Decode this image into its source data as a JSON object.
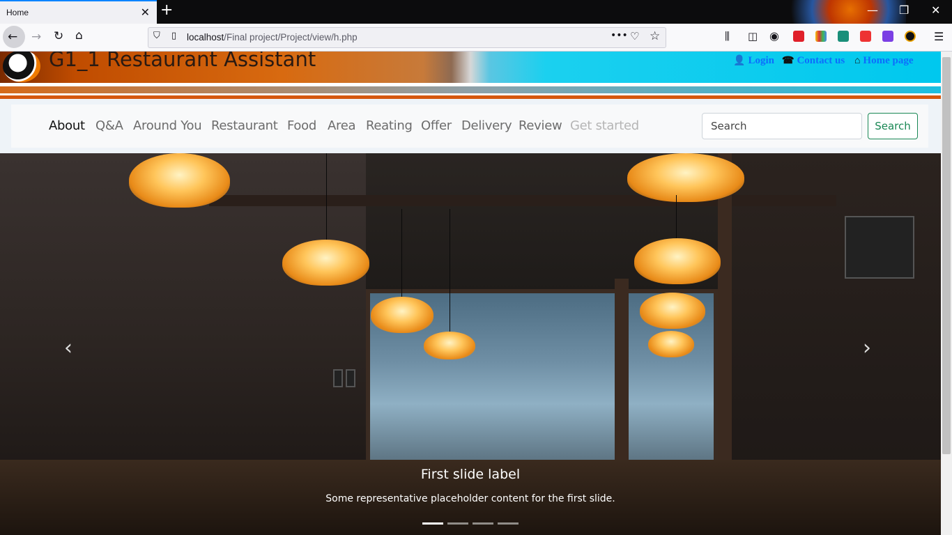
{
  "browser": {
    "tab_title": "Home",
    "url_host": "localhost",
    "url_path": "/Final project/Project/view/h.php"
  },
  "site": {
    "title": "G1_1 Restaurant Assistant",
    "top_links": [
      {
        "label": "Login",
        "icon": "user-icon"
      },
      {
        "label": "Contact us",
        "icon": "phone-icon"
      },
      {
        "label": "Home page",
        "icon": "home-icon"
      }
    ]
  },
  "menu": {
    "items": [
      {
        "label": "About",
        "state": "active"
      },
      {
        "label": "Q&A",
        "state": "normal"
      },
      {
        "label": "Around You",
        "state": "normal"
      },
      {
        "label": "Restaurant",
        "state": "normal"
      },
      {
        "label": "Food",
        "state": "normal"
      },
      {
        "label": "Area",
        "state": "normal"
      },
      {
        "label": "Reating",
        "state": "normal"
      },
      {
        "label": "Offer",
        "state": "normal"
      },
      {
        "label": "Delivery",
        "state": "normal"
      },
      {
        "label": "Review",
        "state": "normal"
      },
      {
        "label": "Get started",
        "state": "disabled"
      }
    ],
    "search_placeholder": "Search",
    "search_button": "Search"
  },
  "carousel": {
    "caption_title": "First slide label",
    "caption_text": "Some representative placeholder content for the first slide.",
    "prev_icon": "chevron-left-icon",
    "next_icon": "chevron-right-icon",
    "slide_count": 4,
    "active_slide": 1
  },
  "colors": {
    "link_blue": "#0d6efd",
    "search_green": "#198754",
    "header_cyan": "#00c8ee",
    "header_orange": "#d86a10"
  }
}
